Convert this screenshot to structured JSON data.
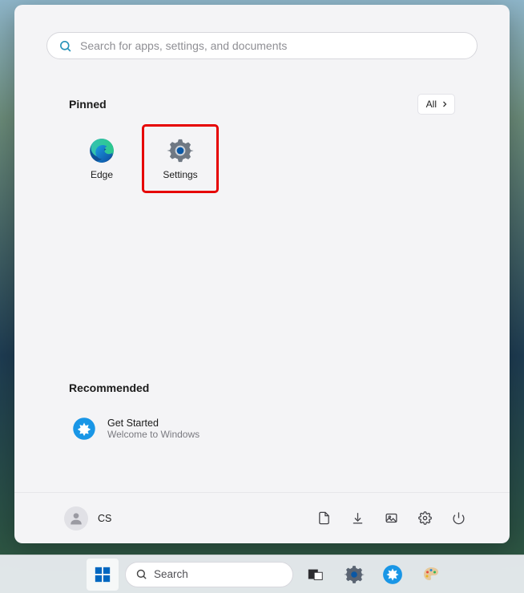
{
  "search": {
    "placeholder": "Search for apps, settings, and documents"
  },
  "pinned": {
    "title": "Pinned",
    "all_label": "All",
    "apps": [
      {
        "label": "Edge"
      },
      {
        "label": "Settings"
      }
    ]
  },
  "recommended": {
    "title": "Recommended",
    "items": [
      {
        "title": "Get Started",
        "subtitle": "Welcome to Windows"
      }
    ]
  },
  "user": {
    "label": "CS"
  },
  "taskbar": {
    "search_label": "Search"
  }
}
